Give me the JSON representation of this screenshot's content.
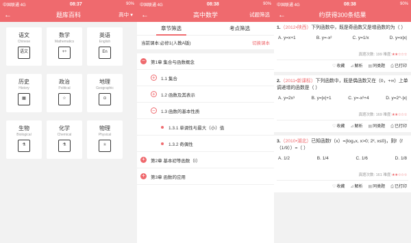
{
  "statusbar": {
    "carrier": "中国联通 4G",
    "time": "08:37",
    "battery": "90%"
  },
  "panel1": {
    "title": "题库百科",
    "grade": "高中 ▾",
    "subjects": [
      {
        "zh": "语文",
        "en": "Chinese",
        "icon": "语文"
      },
      {
        "zh": "数学",
        "en": "Mathematics",
        "icon": "+÷"
      },
      {
        "zh": "英语",
        "en": "English",
        "icon": "En"
      },
      {
        "zh": "历史",
        "en": "History",
        "icon": "▦"
      },
      {
        "zh": "政治",
        "en": "Political",
        "icon": "☆"
      },
      {
        "zh": "地理",
        "en": "Geographic",
        "icon": "⊙"
      },
      {
        "zh": "生物",
        "en": "Biological",
        "icon": "⚗"
      },
      {
        "zh": "化学",
        "en": "Chemical",
        "icon": "⚗"
      },
      {
        "zh": "物理",
        "en": "Physical",
        "icon": "⚛"
      }
    ]
  },
  "panel2": {
    "statusbar_time": "08:38",
    "title": "高中数学",
    "right": "试题筛选",
    "tabs": [
      "章节筛选",
      "考点筛选"
    ],
    "current_book": "当前课本:必修1(人教A版)",
    "switch_label": "切换课本",
    "tree": [
      {
        "level": 1,
        "icon": "−",
        "label": "第1章  集合与函数概念"
      },
      {
        "level": 2,
        "icon": "+",
        "label": "1.1 集合"
      },
      {
        "level": 2,
        "icon": "+",
        "label": "1.2 函数及其表示"
      },
      {
        "level": 2,
        "icon": "−",
        "label": "1.3 函数的基本性质"
      },
      {
        "level": 3,
        "icon": "",
        "label": "1.3.1 单调性与最大（小）值"
      },
      {
        "level": 3,
        "icon": "",
        "label": "1.3.2 奇偶性"
      },
      {
        "level": 1,
        "icon": "+",
        "label": "第2章  基本初等函数（Ⅰ）"
      },
      {
        "level": 1,
        "icon": "+",
        "label": "第3章  函数的应用"
      }
    ]
  },
  "panel3": {
    "statusbar_time": "08:38",
    "title": "约获得300条结果",
    "questions": [
      {
        "no": "1.",
        "source": "（2012•陕西）",
        "text": "下列函数中，既是奇函数又是增函数的为（      ）",
        "options": [
          "A. y=x+1",
          "B. y=-x²",
          "C. y=1/x",
          "D. y=x|x|"
        ],
        "views": "真题次数: 199",
        "difficulty_label": "难度:",
        "stars": "★★☆☆☆"
      },
      {
        "no": "2.",
        "source": "（2011•新课标）",
        "text": "下列函数中，既是偶函数又在（0，+∞）上单调递增的函数是（      ）",
        "options": [
          "A. y=2x³",
          "B. y=|x|+1",
          "C. y=-x²+4",
          "D. y=2^-|x|"
        ],
        "views": "真题次数: 169",
        "difficulty_label": "难度:",
        "stars": "★★☆☆☆"
      },
      {
        "no": "3.",
        "source": "（2010•湖北）",
        "text": "已知函数f（x）={log₃x, x>0; 2ˣ, x≤0}，则f（f（1/9））=（      ）",
        "options": [
          "A. 1/2",
          "B. 1/4",
          "C. 1/6",
          "D. 1/8"
        ],
        "views": "真题次数: 161",
        "difficulty_label": "难度:",
        "stars": "★★☆☆☆"
      }
    ],
    "actions": [
      "收藏",
      "解析",
      "同类题",
      "已打印"
    ]
  }
}
